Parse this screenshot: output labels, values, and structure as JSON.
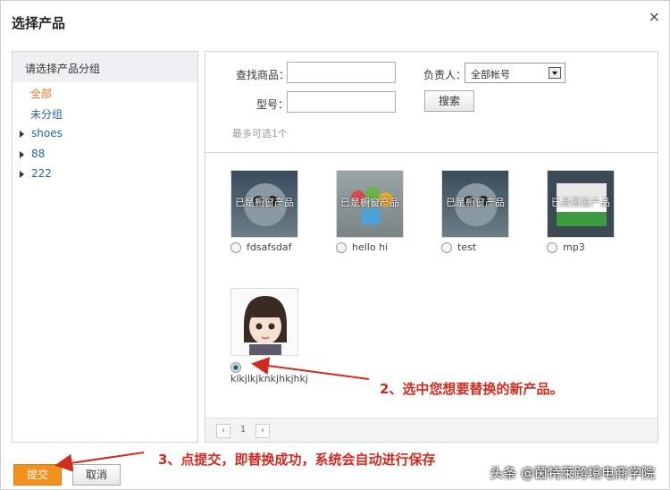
{
  "dialog": {
    "title": "选择产品",
    "close_icon": "×"
  },
  "sidebar": {
    "header": "请选择产品分组",
    "items": [
      {
        "label": "全部"
      },
      {
        "label": "未分组"
      },
      {
        "label": "shoes"
      },
      {
        "label": "88"
      },
      {
        "label": "222"
      }
    ]
  },
  "filters": {
    "product_label": "查找商品：",
    "product_value": "",
    "owner_label": "负责人：",
    "owner_selected": "全部帐号",
    "model_label": "型号：",
    "model_value": "",
    "search_button": "搜索",
    "hint": "最多可选1个"
  },
  "products": [
    {
      "name": "fdsafsdaf",
      "overlay": "已是橱窗产品",
      "selected": false
    },
    {
      "name": "hello hi",
      "overlay": "已是橱窗产品",
      "selected": false
    },
    {
      "name": "test",
      "overlay": "已是橱窗产品",
      "selected": false
    },
    {
      "name": "mp3",
      "overlay": "已是橱窗产品",
      "selected": false
    },
    {
      "name": "klkjlkjknkjhkjhkj",
      "overlay": "",
      "selected": true
    }
  ],
  "pager": {
    "prev": "‹",
    "page": "1",
    "next": "›"
  },
  "footer": {
    "submit": "提交",
    "cancel": "取消"
  },
  "annotations": {
    "step2": "2、选中您想要替换的新产品。",
    "step3": "3、点提交，即替换成功，系统会自动进行保存"
  },
  "watermark": "头条 @茵特莱跨境电商学院",
  "colors": {
    "accent": "#f0921c",
    "link": "#2a62a6",
    "annotation": "#d32a1f",
    "active_group": "#e6731a"
  }
}
